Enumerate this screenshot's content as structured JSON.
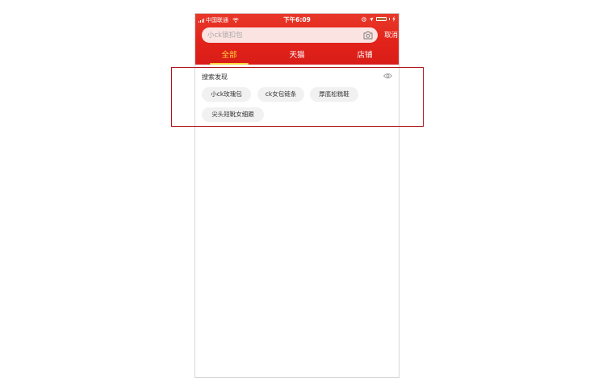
{
  "status_bar": {
    "carrier": "中国联通",
    "time": "下午6:09"
  },
  "search": {
    "placeholder": "小ck锁扣包",
    "camera_icon": "camera-icon",
    "cancel_label": "取消"
  },
  "tabs": [
    {
      "label": "全部",
      "active": true
    },
    {
      "label": "天猫",
      "active": false
    },
    {
      "label": "店铺",
      "active": false
    }
  ],
  "discover": {
    "title": "搜索发现",
    "visibility_icon": "eye-icon",
    "chips": [
      "小ck玫瑰包",
      "ck女包链条",
      "厚底松糕鞋",
      "尖头短靴女细跟"
    ]
  },
  "colors": {
    "header_red": "#e2231a",
    "active_tab": "#ffd43b",
    "chip_bg": "#f1f1f1",
    "highlight_border": "#b01217"
  }
}
